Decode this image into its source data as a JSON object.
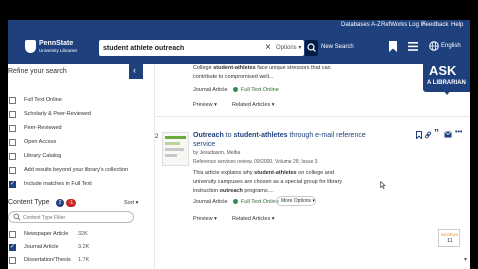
{
  "util_bar": {
    "links": [
      "Databases A-Z",
      "RefWorks Log In",
      "Feedback",
      "Help"
    ]
  },
  "header": {
    "logo_line1": "PennState",
    "logo_line2": "University Libraries",
    "search_value": "student athlete outreach",
    "options_label": "Options",
    "new_search_label": "New Search",
    "language_label": "English",
    "brand_color": "#1e407c"
  },
  "sidebar": {
    "refine_title": "Refine your search",
    "refine_items": [
      {
        "label": "Full Text Online",
        "checked": false
      },
      {
        "label": "Scholarly & Peer-Reviewed",
        "checked": false
      },
      {
        "label": "Peer-Reviewed",
        "checked": false
      },
      {
        "label": "Open Access",
        "checked": false
      },
      {
        "label": "Library Catalog",
        "checked": false
      },
      {
        "label": "Add results beyond your library's collection",
        "checked": false
      },
      {
        "label": "Include matches in Full Text",
        "checked": true
      }
    ],
    "content_type_title": "Content Type",
    "badge_include": "2",
    "badge_exclude": "-1",
    "sort_label": "Sort",
    "filter_placeholder": "Content Type Filter",
    "content_types": [
      {
        "label": "Newspaper Article",
        "count": "32K",
        "checked": false
      },
      {
        "label": "Journal Article",
        "count": "3.2K",
        "checked": true
      },
      {
        "label": "Dissertation/Thesis",
        "count": "1.7K",
        "checked": false
      }
    ]
  },
  "result1": {
    "snippet_line1_pre": "College ",
    "snippet_line1_bold": "student-athletes",
    "snippet_line1_post": " face unique stressors that can",
    "snippet_line2": "contribute to compromised well...",
    "type": "Journal Article",
    "access": "Full Text Online",
    "preview_label": "Preview",
    "related_label": "Related Articles"
  },
  "result2": {
    "number": "2",
    "title_parts": [
      "Outreach",
      " to ",
      "student-athletes",
      " through e-mail reference"
    ],
    "title_line2": "service",
    "author": "by Jesudason, Melba",
    "source": "Reference services review, 09/2000, Volume 28, Issue 3",
    "abstract_line1_pre": "This article explains why ",
    "abstract_line1_bold": "student-athletes",
    "abstract_line1_post": " on college and",
    "abstract_line2": "university campuses are chosen as a special group for library",
    "abstract_line3_pre": "instruction ",
    "abstract_line3_bold": "outreach",
    "abstract_line3_post": " programs....",
    "type": "Journal Article",
    "access": "Full Text Online",
    "more_options_label": "More Options",
    "preview_label": "Preview",
    "related_label": "Related Articles"
  },
  "ask_widget": {
    "line1": "ASK",
    "line2": "A LIBRARIAN"
  },
  "scopus": {
    "label": "SCOPUS",
    "count": "11"
  }
}
